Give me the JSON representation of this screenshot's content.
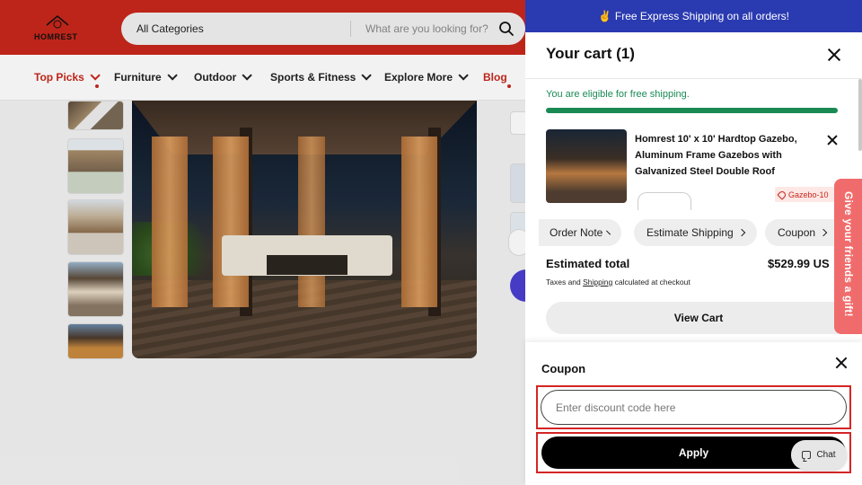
{
  "header": {
    "logo_text": "HOMREST",
    "search": {
      "category": "All Categories",
      "placeholder": "What are you looking for?"
    }
  },
  "nav": {
    "items": [
      {
        "label": "Top Picks"
      },
      {
        "label": "Furniture"
      },
      {
        "label": "Outdoor"
      },
      {
        "label": "Sports & Fitness"
      },
      {
        "label": "Explore More"
      },
      {
        "label": "Blog"
      }
    ]
  },
  "cart": {
    "banner": "Free Express Shipping on all orders!",
    "banner_icon": "✌️",
    "title": "Your cart (1)",
    "free_shipping_message": "You are eligible for free shipping.",
    "free_shipping_progress": 1.0,
    "item": {
      "name": "Homrest 10' x 10' Hardtop Gazebo, Aluminum Frame Gazebos with Galvanized Steel Double Roof",
      "badge": "Gazebo-10"
    },
    "actions": [
      {
        "label": "Order Note"
      },
      {
        "label": "Estimate Shipping"
      },
      {
        "label": "Coupon"
      }
    ],
    "estimated_total_label": "Estimated total",
    "estimated_total_value": "$529.99 US",
    "tax_note_prefix": "Taxes and ",
    "tax_note_link": "Shipping",
    "tax_note_suffix": " calculated at checkout",
    "view_cart_label": "View Cart"
  },
  "gift_tab": {
    "label": "Give your friends a gift!"
  },
  "coupon": {
    "title": "Coupon",
    "input_value": "",
    "input_placeholder": "Enter discount code here",
    "apply_label": "Apply"
  },
  "chat": {
    "label": "Chat"
  },
  "colors": {
    "header_red": "#c8281c",
    "banner_blue": "#2a3ab0",
    "success_green": "#1a8a55",
    "highlight_red": "#d42525",
    "gift_tab": "#f06c6c"
  }
}
